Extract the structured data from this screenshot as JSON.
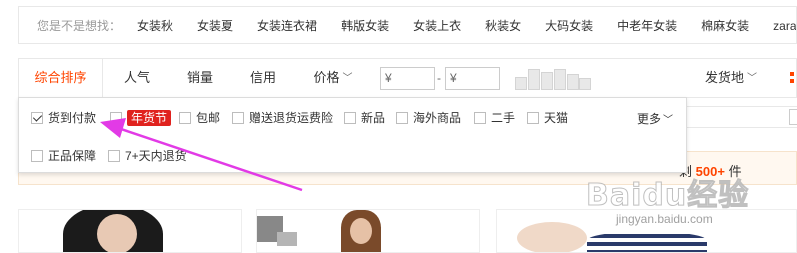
{
  "suggest": {
    "label": "您是不是想找：",
    "keywords": [
      "女装秋",
      "女装夏",
      "女装连衣裙",
      "韩版女装",
      "女装上衣",
      "秋装女",
      "大码女装",
      "中老年女装",
      "棉麻女装",
      "zara女装"
    ]
  },
  "sortbar": {
    "tabs": [
      {
        "label": "综合排序",
        "active": true
      },
      {
        "label": "人气"
      },
      {
        "label": "销量"
      },
      {
        "label": "信用"
      },
      {
        "label": "价格"
      }
    ],
    "price_from": "¥",
    "price_dash": "-",
    "price_to": "¥",
    "ship_from": "发货地"
  },
  "filters": {
    "options": [
      {
        "label": "货到付款",
        "checked": true
      },
      {
        "label": "年货节",
        "checked": false,
        "highlight": true
      },
      {
        "label": "包邮",
        "checked": false
      },
      {
        "label": "赠送退货运费险",
        "checked": false
      },
      {
        "label": "新品",
        "checked": false
      },
      {
        "label": "海外商品",
        "checked": false
      },
      {
        "label": "二手",
        "checked": false
      },
      {
        "label": "天猫",
        "checked": false
      },
      {
        "label": "正品保障",
        "checked": false
      },
      {
        "label": "7+天内退货",
        "checked": false
      }
    ],
    "more": "更多"
  },
  "results": {
    "prefix": "剩",
    "count": "500+",
    "unit": "件"
  },
  "watermark": {
    "brand": "Baidu经验",
    "url": "jingyan.baidu.com"
  },
  "colors": {
    "accent": "#ff4400",
    "tag_red": "#e0221e",
    "arrow": "#e23ae6"
  }
}
